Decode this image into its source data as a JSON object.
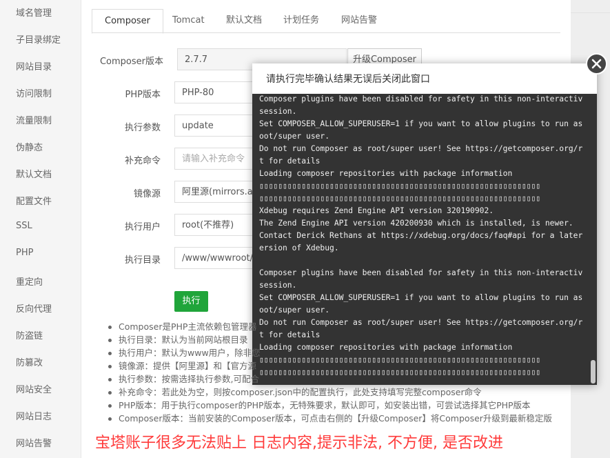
{
  "sidebar": {
    "items": [
      "域名管理",
      "子目录绑定",
      "网站目录",
      "访问限制",
      "流量限制",
      "伪静态",
      "默认文档",
      "配置文件",
      "SSL",
      "PHP",
      "重定向",
      "反向代理",
      "防盗链",
      "防篡改",
      "网站安全",
      "网站日志",
      "网站告警"
    ]
  },
  "tabs": [
    "Composer",
    "Tomcat",
    "默认文档",
    "计划任务",
    "网站告警"
  ],
  "form": {
    "composer_version_label": "Composer版本",
    "composer_version_value": "2.7.7",
    "upgrade_button": "升级Composer",
    "php_version_label": "PHP版本",
    "php_version_value": "PHP-80",
    "exec_param_label": "执行参数",
    "exec_param_value": "update",
    "extra_cmd_label": "补充命令",
    "extra_cmd_placeholder": "请输入补充命令",
    "mirror_label": "镜像源",
    "mirror_value": "阿里源(mirrors.aliy",
    "user_label": "执行用户",
    "user_value": "root(不推荐)",
    "dir_label": "执行目录",
    "dir_value": "/www/wwwroot/e",
    "execute_button": "执行"
  },
  "notes": [
    "Composer是PHP主流依赖包管理器",
    "执行目录：默认为当前网站根目录",
    "执行用户：默认为www用户，除非您",
    "镜像源：提供【阿里源】和【官方源",
    "执行参数：按需选择执行参数,可配合",
    "补充命令：若此处为空，则按composer.json中的配置执行，此处支持填写完整composer命令",
    "PHP版本：用于执行composer的PHP版本，无特殊要求，默认即可，如安装出错，可尝试选择其它PHP版本",
    "Composer版本：当前安装的Composer版本，可点击右侧的【升级Composer】将Composer升级到最新稳定版"
  ],
  "dialog": {
    "title": "请执行完毕确认结果无误后关闭此窗口",
    "console_lines": [
      "Composer plugins have been disabled for safety in this non-interactive",
      "session.",
      "Set COMPOSER_ALLOW_SUPERUSER=1 if you want to allow plugins to run as r",
      "oot/super user.",
      "Do not run Composer as root/super user! See https://getcomposer.org/roo",
      "t for details",
      "Loading composer repositories with package information",
      "▯▯▯▯▯▯▯▯▯▯▯▯▯▯▯▯▯▯▯▯▯▯▯▯▯▯▯▯▯▯▯▯▯▯▯▯▯▯▯▯▯▯▯▯▯▯▯▯▯▯▯▯▯▯▯▯▯▯▯▯",
      "▯▯▯▯▯▯▯▯▯▯▯▯▯▯▯▯▯▯▯▯▯▯▯▯▯▯▯▯▯▯▯▯▯▯▯▯▯▯▯▯▯▯▯▯▯▯▯▯▯▯▯▯▯▯▯▯▯▯▯▯",
      "Xdebug requires Zend Engine API version 320190902.",
      "The Zend Engine API version 420200930 which is installed, is newer.",
      "Contact Derick Rethans at https://xdebug.org/docs/faq#api for a later v",
      "ersion of Xdebug.",
      "",
      "Composer plugins have been disabled for safety in this non-interactive",
      "session.",
      "Set COMPOSER_ALLOW_SUPERUSER=1 if you want to allow plugins to run as r",
      "oot/super user.",
      "Do not run Composer as root/super user! See https://getcomposer.org/roo",
      "t for details",
      "Loading composer repositories with package information",
      "▯▯▯▯▯▯▯▯▯▯▯▯▯▯▯▯▯▯▯▯▯▯▯▯▯▯▯▯▯▯▯▯▯▯▯▯▯▯▯▯▯▯▯▯▯▯▯▯▯▯▯▯▯▯▯▯▯▯▯▯",
      "▯▯▯▯▯▯▯▯▯▯▯▯▯▯▯▯▯▯▯▯▯▯▯▯▯▯▯▯▯▯▯▯▯▯▯▯▯▯▯▯▯▯▯▯▯▯▯▯▯▯▯▯▯▯▯▯▯▯▯▯"
    ]
  },
  "caption": "宝塔账子很多无法贴上 日志内容,提示非法, 不方便, 是否改进",
  "colors": {
    "accent_green": "#20a53a",
    "console_bg": "#333333",
    "caption_red": "#ff3a3a"
  }
}
